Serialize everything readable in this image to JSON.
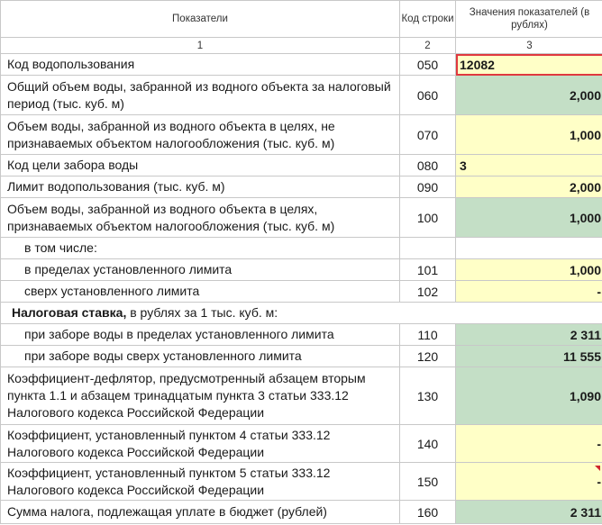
{
  "header": {
    "col1": "Показатели",
    "col2": "Код строки",
    "col3": "Значения показателей (в рублях)"
  },
  "col_numbers": [
    "1",
    "2",
    "3"
  ],
  "rows": [
    {
      "label": "Код водопользования",
      "code": "050",
      "value": "12082",
      "fill": "yellow",
      "selected": true
    },
    {
      "label": "Общий объем воды, забранной из водного объекта за налоговый период (тыс. куб. м)",
      "code": "060",
      "value": "2,000",
      "fill": "green"
    },
    {
      "label": "Объем воды, забранной из водного объекта в целях, не признаваемых объектом налогообложения (тыс. куб. м)",
      "code": "070",
      "value": "1,000",
      "fill": "yellow"
    },
    {
      "label": "Код цели забора воды",
      "code": "080",
      "value": "3",
      "fill": "yellow"
    },
    {
      "label": "Лимит водопользования (тыс. куб. м)",
      "code": "090",
      "value": "2,000",
      "fill": "yellow"
    },
    {
      "label": "Объем воды, забранной из водного объекта в целях, признаваемых объектом налогообложения (тыс. куб. м)",
      "code": "100",
      "value": "1,000",
      "fill": "green"
    },
    {
      "label": "в том числе:",
      "code": "",
      "value": "",
      "fill": "white"
    },
    {
      "label": "в пределах установленного лимита",
      "code": "101",
      "value": "1,000",
      "fill": "yellow"
    },
    {
      "label": "сверх установленного лимита",
      "code": "102",
      "value": "-",
      "fill": "yellow"
    },
    {
      "label_bold": "Налоговая ставка,",
      "label_rest": " в рублях за 1 тыс. куб. м:",
      "code": "",
      "value": "",
      "fill": "white"
    },
    {
      "label": "при заборе воды в пределах установленного лимита",
      "code": "110",
      "value": "2 311",
      "fill": "green"
    },
    {
      "label": "при заборе воды сверх установленного лимита",
      "code": "120",
      "value": "11 555",
      "fill": "green"
    },
    {
      "label": "Коэффициент-дефлятор, предусмотренный абзацем вторым пункта 1.1 и абзацем тринадцатым пункта 3 статьи 333.12 Налогового кодекса Российской Федерации",
      "code": "130",
      "value": "1,090",
      "fill": "green"
    },
    {
      "label": "Коэффициент, установленный пунктом 4 статьи 333.12 Налогового кодекса Российской Федерации",
      "code": "140",
      "value": "-",
      "fill": "yellow"
    },
    {
      "label": "Коэффициент, установленный пунктом 5 статьи 333.12 Налогового кодекса Российской Федерации",
      "code": "150",
      "value": "-",
      "fill": "yellow"
    },
    {
      "label": "Сумма налога, подлежащая уплате в бюджет (рублей)",
      "code": "160",
      "value": "2 311",
      "fill": "green"
    }
  ]
}
